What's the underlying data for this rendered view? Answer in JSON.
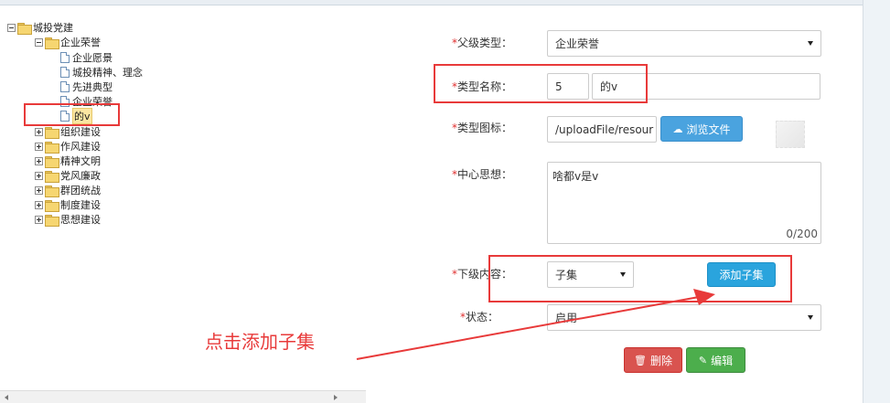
{
  "tree": {
    "root": {
      "label": "城投党建",
      "expander": "minus"
    },
    "group_expanded": {
      "label": "企业荣誉",
      "expander": "minus"
    },
    "children": [
      {
        "label": "企业愿景"
      },
      {
        "label": "城投精神、理念"
      },
      {
        "label": "先进典型"
      },
      {
        "label": "企业荣誉"
      },
      {
        "label": "的v",
        "selected": true
      }
    ],
    "groups": [
      {
        "label": "组织建设"
      },
      {
        "label": "作风建设"
      },
      {
        "label": "精神文明"
      },
      {
        "label": "党风廉政"
      },
      {
        "label": "群团统战"
      },
      {
        "label": "制度建设"
      },
      {
        "label": "思想建设"
      }
    ]
  },
  "form": {
    "required_mark": "*",
    "parent_type_label": "父级类型：",
    "parent_type_value": "企业荣誉",
    "type_name_label": "类型名称：",
    "type_name_sort": "5",
    "type_name_value": "的v",
    "type_icon_label": "类型图标：",
    "type_icon_path": "/uploadFile/resour",
    "browse_button": "浏览文件",
    "center_idea_label": "中心思想：",
    "center_idea_value": "啥都v是v",
    "center_idea_counter": "0/200",
    "sub_content_label": "下级内容：",
    "sub_content_value": "子集",
    "add_child_button": "添加子集",
    "status_label": "状态：",
    "status_value": "启用",
    "delete_button": "删除",
    "edit_button": "编辑"
  },
  "annotation": {
    "text": "点击添加子集",
    "color": "#e83a3a"
  },
  "icons": [
    "minus-expander-icon",
    "plus-expander-icon",
    "folder-icon",
    "document-icon",
    "cloud-upload-icon",
    "trash-icon",
    "pencil-icon",
    "dropdown-caret-icon"
  ]
}
